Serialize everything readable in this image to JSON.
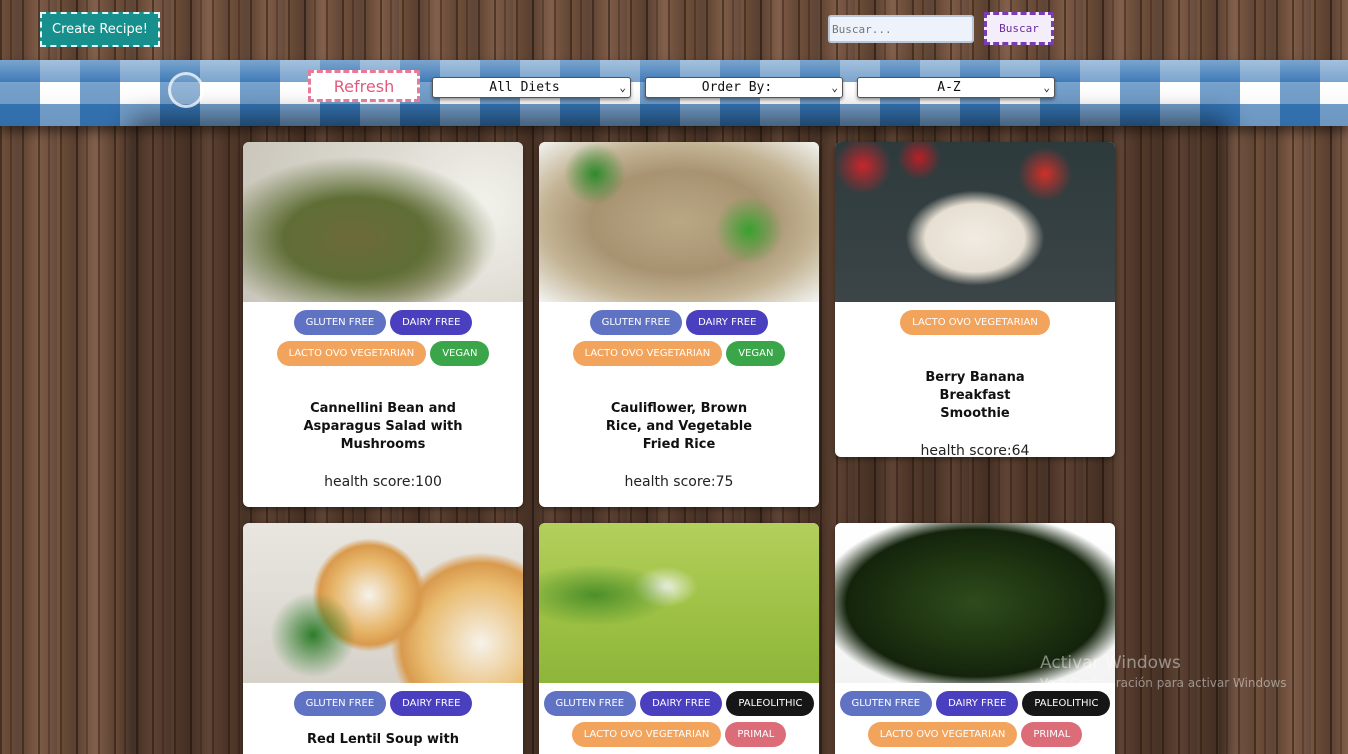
{
  "header": {
    "create_label": "Create Recipe!",
    "search_placeholder": "Buscar...",
    "search_label": "Buscar"
  },
  "filters": {
    "refresh_label": "Refresh",
    "diet_select": "All Diets",
    "order_select": "Order By:",
    "sort_select": "A-Z"
  },
  "recipes": [
    {
      "title": "Cannellini Bean and Asparagus Salad with Mushrooms",
      "health_label": "health score:100",
      "diets": [
        "GLUTEN FREE",
        "DAIRY FREE",
        "LACTO OVO VEGETARIAN",
        "VEGAN"
      ]
    },
    {
      "title": "Cauliflower, Brown Rice, and Vegetable Fried Rice",
      "health_label": "health score:75",
      "diets": [
        "GLUTEN FREE",
        "DAIRY FREE",
        "LACTO OVO VEGETARIAN",
        "VEGAN"
      ]
    },
    {
      "title": "Berry Banana Breakfast Smoothie",
      "health_label": "health score:64",
      "diets": [
        "LACTO OVO VEGETARIAN"
      ]
    },
    {
      "title": "Red Lentil Soup with",
      "health_label": "",
      "diets": [
        "GLUTEN FREE",
        "DAIRY FREE"
      ]
    },
    {
      "title": "",
      "health_label": "",
      "diets": [
        "GLUTEN FREE",
        "DAIRY FREE",
        "PALEOLITHIC",
        "LACTO OVO VEGETARIAN",
        "PRIMAL"
      ]
    },
    {
      "title": "",
      "health_label": "",
      "diets": [
        "GLUTEN FREE",
        "DAIRY FREE",
        "PALEOLITHIC",
        "LACTO OVO VEGETARIAN",
        "PRIMAL"
      ]
    }
  ],
  "watermark": {
    "line1": "Activar Windows",
    "line2": "Ve a Configuración para activar Windows"
  }
}
